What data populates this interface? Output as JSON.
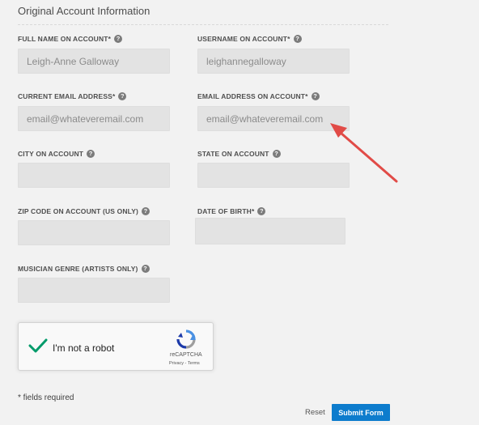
{
  "section": {
    "title": "Original Account Information"
  },
  "fields": {
    "full_name": {
      "label": "FULL NAME ON ACCOUNT*",
      "value": "Leigh-Anne Galloway"
    },
    "username": {
      "label": "USERNAME ON ACCOUNT*",
      "value": "leighannegalloway"
    },
    "current_email": {
      "label": "CURRENT EMAIL ADDRESS*",
      "value": "email@whateveremail.com"
    },
    "account_email": {
      "label": "EMAIL ADDRESS ON ACCOUNT*",
      "value": "email@whateveremail.com"
    },
    "city": {
      "label": "CITY ON ACCOUNT",
      "value": ""
    },
    "state": {
      "label": "STATE ON ACCOUNT",
      "value": ""
    },
    "zip": {
      "label": "ZIP CODE ON ACCOUNT (US ONLY)",
      "value": ""
    },
    "dob": {
      "label": "DATE OF BIRTH*",
      "value": ""
    },
    "genre": {
      "label": "MUSICIAN GENRE (ARTISTS ONLY)",
      "value": ""
    }
  },
  "help_icon_glyph": "?",
  "recaptcha": {
    "label": "I'm not a robot",
    "brand": "reCAPTCHA",
    "links": "Privacy - Terms"
  },
  "footer": {
    "required_note": "* fields required",
    "reset_label": "Reset",
    "submit_label": "Submit Form"
  },
  "colors": {
    "background": "#f2f2f2",
    "input_bg": "#e3e3e3",
    "submit_bg": "#0d7ccd",
    "checkmark": "#009b6a",
    "arrow": "#e14b47"
  },
  "icons": {
    "help": "question-circle-icon",
    "check": "checkmark-icon",
    "captcha": "recaptcha-logo-icon",
    "annotation": "red-arrow-icon"
  }
}
